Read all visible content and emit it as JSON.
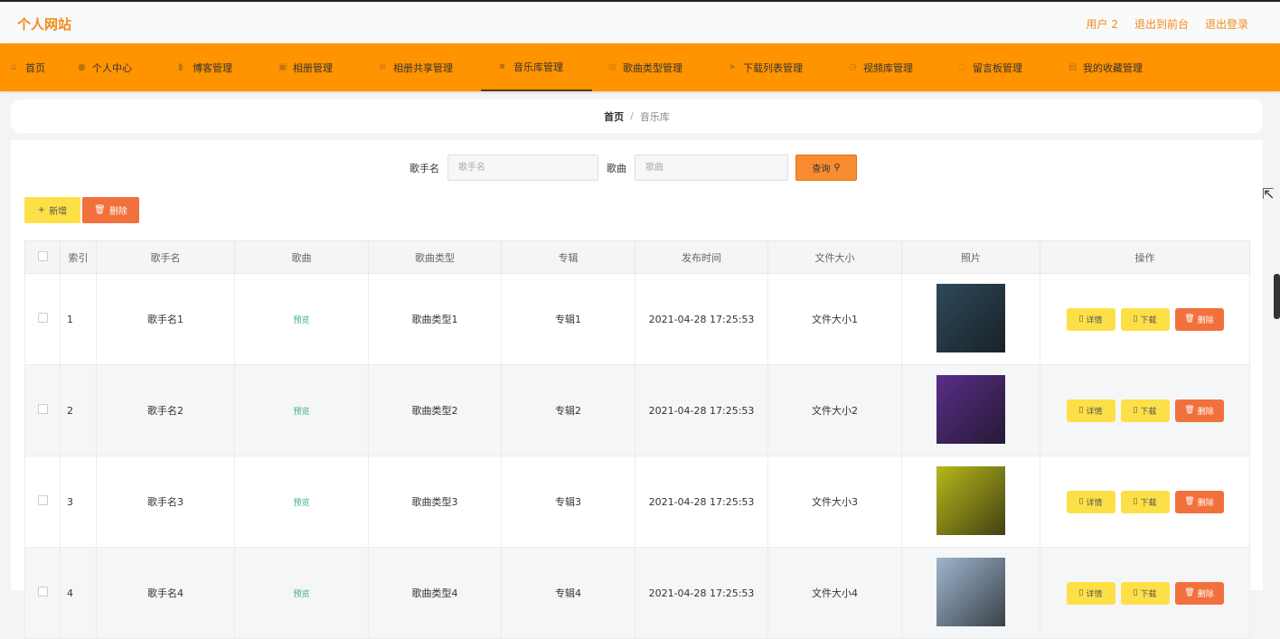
{
  "header": {
    "site_title": "个人网站",
    "user_label": "用户 2",
    "to_front_label": "退出到前台",
    "logout_label": "退出登录"
  },
  "nav": {
    "active_index": 4,
    "items": [
      {
        "label": "首页",
        "icon": "home-icon"
      },
      {
        "label": "个人中心",
        "icon": "user-icon"
      },
      {
        "label": "博客管理",
        "icon": "bar-chart-icon"
      },
      {
        "label": "相册管理",
        "icon": "film-icon"
      },
      {
        "label": "相册共享管理",
        "icon": "list-icon"
      },
      {
        "label": "音乐库管理",
        "icon": "lock-icon"
      },
      {
        "label": "歌曲类型管理",
        "icon": "compass-icon"
      },
      {
        "label": "下载列表管理",
        "icon": "send-icon"
      },
      {
        "label": "视频库管理",
        "icon": "clock-icon"
      },
      {
        "label": "留言板管理",
        "icon": "power-icon"
      },
      {
        "label": "我的收藏管理",
        "icon": "document-icon"
      }
    ]
  },
  "breadcrumb": {
    "home": "首页",
    "separator": "/",
    "current": "音乐库"
  },
  "search": {
    "singer_label": "歌手名",
    "singer_placeholder": "歌手名",
    "song_label": "歌曲",
    "song_placeholder": "歌曲",
    "query_label": "查询"
  },
  "actions": {
    "add_label": "新增",
    "delete_label": "删除"
  },
  "table": {
    "headers": [
      "",
      "索引",
      "歌手名",
      "歌曲",
      "歌曲类型",
      "专辑",
      "发布时间",
      "文件大小",
      "照片",
      "操作"
    ],
    "rows": [
      {
        "index": "1",
        "singer": "歌手名1",
        "song": "预览",
        "type": "歌曲类型1",
        "album": "专辑1",
        "time": "2021-04-28 17:25:53",
        "size": "文件大小1",
        "photo_color": "#2f4a5c"
      },
      {
        "index": "2",
        "singer": "歌手名2",
        "song": "预览",
        "type": "歌曲类型2",
        "album": "专辑2",
        "time": "2021-04-28 17:25:53",
        "size": "文件大小2",
        "photo_color": "#5a2e8a"
      },
      {
        "index": "3",
        "singer": "歌手名3",
        "song": "预览",
        "type": "歌曲类型3",
        "album": "专辑3",
        "time": "2021-04-28 17:25:53",
        "size": "文件大小3",
        "photo_color": "#b7b81a"
      },
      {
        "index": "4",
        "singer": "歌手名4",
        "song": "预览",
        "type": "歌曲类型4",
        "album": "专辑4",
        "time": "2021-04-28 17:25:53",
        "size": "文件大小4",
        "photo_color": "#9fb6cf"
      }
    ],
    "op_labels": {
      "detail": "详情",
      "download": "下载",
      "delete": "删除"
    }
  },
  "colors": {
    "accent": "#ff9300",
    "title": "#f08c1e",
    "danger": "#f2703c",
    "warning": "#fde047"
  }
}
